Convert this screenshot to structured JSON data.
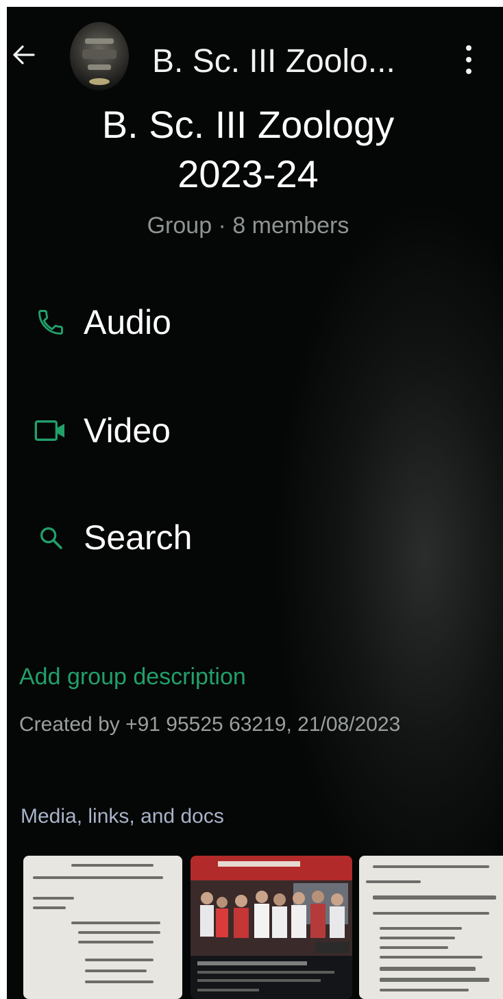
{
  "appbar": {
    "title": "B. Sc. III Zoolo..."
  },
  "profile": {
    "group_name": "B. Sc. III Zoology 2023-24",
    "meta": "Group · 8 members"
  },
  "actions": [
    {
      "label": "Audio",
      "icon": "phone-icon"
    },
    {
      "label": "Video",
      "icon": "video-camera-icon"
    },
    {
      "label": "Search",
      "icon": "search-icon"
    }
  ],
  "description": {
    "link": "Add group description",
    "created": "Created by +91 95525 63219, 21/08/2023"
  },
  "media": {
    "header": "Media, links, and docs",
    "items": [
      "document-thumbnail",
      "photo-thumbnail",
      "document-thumbnail"
    ]
  },
  "colors": {
    "accent": "#21a06a",
    "background": "#0b0c0c",
    "text": "#ffffff",
    "muted": "#8e9591",
    "media_header": "#a9b3c8"
  }
}
